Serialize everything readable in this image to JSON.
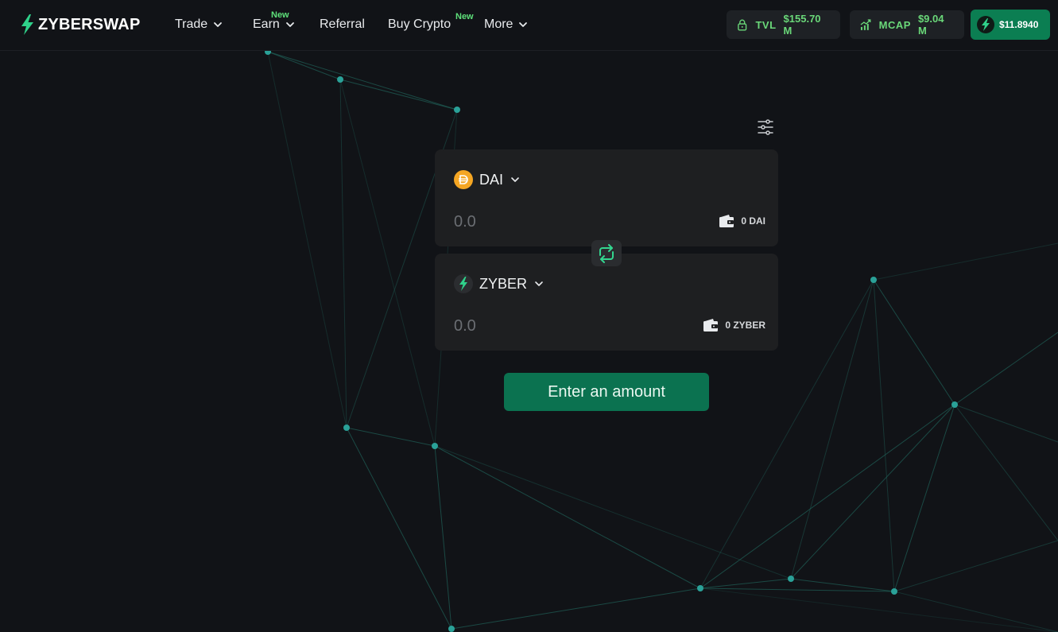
{
  "brand": {
    "name": "ZYBERSWAP"
  },
  "nav": {
    "items": [
      {
        "label": "Trade",
        "badge": ""
      },
      {
        "label": "Earn",
        "badge": "New"
      },
      {
        "label": "Referral",
        "badge": ""
      },
      {
        "label": "Buy Crypto",
        "badge": "New"
      },
      {
        "label": "More",
        "badge": ""
      }
    ]
  },
  "stats": {
    "tvl": {
      "label": "TVL",
      "value": "$155.70 M",
      "icon": "lock-icon"
    },
    "mcap": {
      "label": "MCAP",
      "value": "$9.04 M",
      "icon": "chart-icon"
    },
    "price": {
      "value": "$11.8940",
      "icon": "bolt-icon"
    }
  },
  "swap": {
    "from": {
      "token": "DAI",
      "placeholder": "0.0",
      "balance": "0 DAI",
      "icon": "dai-icon"
    },
    "to": {
      "token": "ZYBER",
      "placeholder": "0.0",
      "balance": "0 ZYBER",
      "icon": "zyber-bolt-icon"
    },
    "action_label": "Enter an amount"
  },
  "colors": {
    "background": "#111317",
    "card": "#1e1f21",
    "accent_green": "#0b7250",
    "stat_green": "#6ad879",
    "badge_green": "#5ee07a",
    "network_line": "#1d5a52",
    "network_node": "#2aa198",
    "dai_orange": "#f5a623"
  }
}
